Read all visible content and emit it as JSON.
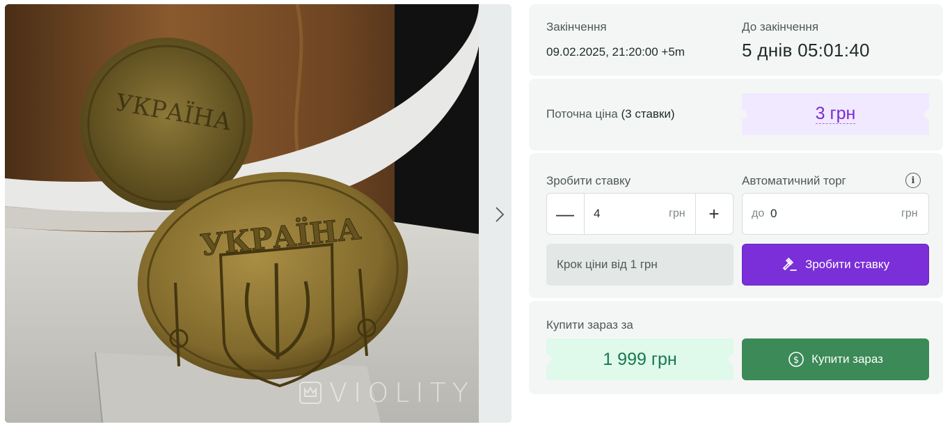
{
  "gallery": {
    "watermark": "VIOLITY",
    "coin_text": "УКРАЇНА"
  },
  "auction": {
    "end_label": "Закінчення",
    "end_value": "09.02.2025, 21:20:00 +5m",
    "remaining_label": "До закінчення",
    "remaining_value": "5 днів 05:01:40"
  },
  "price": {
    "label": "Поточна ціна",
    "bids_count": "(3 ставки)",
    "value": "3 грн"
  },
  "bid": {
    "label": "Зробити ставку",
    "amount": "4",
    "currency": "грн",
    "minus": "—",
    "plus": "+",
    "auto_label": "Автоматичний торг",
    "auto_prefix": "до",
    "auto_amount": "0",
    "auto_currency": "грн",
    "step_text": "Крок ціни від 1 грн",
    "submit_label": "Зробити ставку"
  },
  "buy_now": {
    "label": "Купити зараз за",
    "price": "1 999 грн",
    "button_label": "Купити зараз"
  },
  "colors": {
    "accent_purple": "#7b2fd8",
    "accent_green": "#3b8a57",
    "price_purple": "#7a2bd6",
    "price_green": "#157a4a",
    "card_bg": "#f4f6f5"
  },
  "icons": [
    "chevron-right-icon",
    "gavel-icon",
    "dollar-coin-icon",
    "info-icon",
    "violity-crown-icon"
  ]
}
